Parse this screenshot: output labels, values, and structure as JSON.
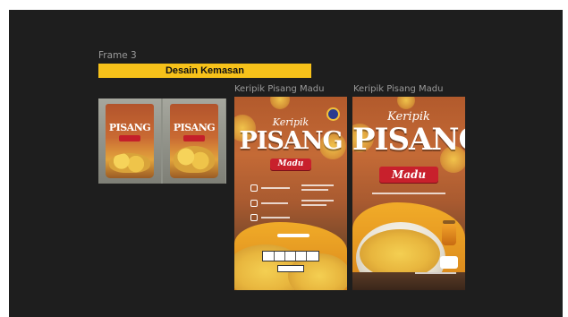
{
  "canvas": {
    "frame_label": "Frame 3",
    "section_title": "Desain Kemasan"
  },
  "designs": [
    {
      "label": "Keripik Pisang Madu"
    },
    {
      "label": "Keripik Pisang Madu"
    }
  ],
  "package_text": {
    "keripik": "Keripik",
    "pisang": "PISANG",
    "madu": "Madu"
  },
  "photo_bag_text": {
    "pisang": "PISANG"
  },
  "colors": {
    "canvas_bg": "#1e1e1e",
    "title_bar": "#f7c21a",
    "label_text": "#9a9a9a",
    "madu_banner": "#c8202c"
  }
}
